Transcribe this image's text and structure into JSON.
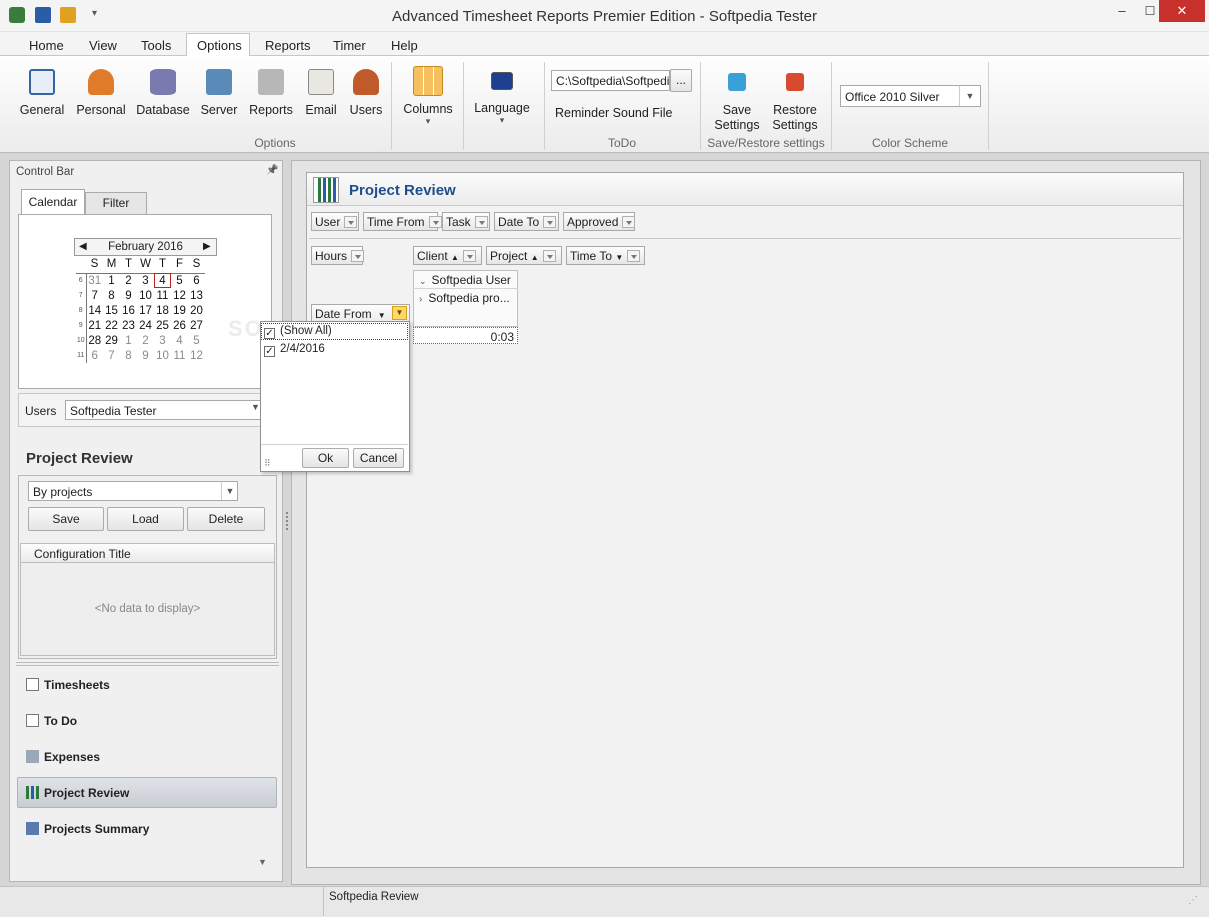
{
  "window": {
    "title": "Advanced Timesheet Reports Premier Edition - Softpedia Tester",
    "minimize": "–",
    "maximize": "☐",
    "close": "✕"
  },
  "menu": [
    "Home",
    "View",
    "Tools",
    "Options",
    "Reports",
    "Timer",
    "Help"
  ],
  "ribbon": {
    "options_buttons": [
      "General",
      "Personal",
      "Database",
      "Server",
      "Reports",
      "Email",
      "Users",
      "Columns",
      "Language"
    ],
    "options_group": "Options",
    "todo_path": "C:\\Softpedia\\Softpedia",
    "browse": "...",
    "reminder_label": "Reminder Sound File",
    "todo_group": "ToDo",
    "save_settings": "Save Settings",
    "restore_settings": "Restore Settings",
    "saverestore_group": "Save/Restore settings",
    "color_scheme_value": "Office 2010 Silver",
    "color_scheme_group": "Color Scheme",
    "colors": {
      "accent": "#1f4e8c",
      "ribbon": "#f4f4f4"
    }
  },
  "control_bar": {
    "title": "Control Bar",
    "pin": "📌",
    "tabs": [
      "Calendar",
      "Filter"
    ],
    "calendar": {
      "month": "February 2016",
      "weekdays": [
        "S",
        "M",
        "T",
        "W",
        "T",
        "F",
        "S"
      ],
      "weeks": [
        {
          "wk": "6",
          "days": [
            [
              "31",
              true
            ],
            [
              "1",
              false
            ],
            [
              "2",
              false
            ],
            [
              "3",
              false
            ],
            [
              "4",
              false
            ],
            [
              "5",
              false
            ],
            [
              "6",
              false
            ]
          ]
        },
        {
          "wk": "7",
          "days": [
            [
              "7",
              false
            ],
            [
              "8",
              false
            ],
            [
              "9",
              false
            ],
            [
              "10",
              false
            ],
            [
              "11",
              false
            ],
            [
              "12",
              false
            ],
            [
              "13",
              false
            ]
          ]
        },
        {
          "wk": "8",
          "days": [
            [
              "14",
              false
            ],
            [
              "15",
              false
            ],
            [
              "16",
              false
            ],
            [
              "17",
              false
            ],
            [
              "18",
              false
            ],
            [
              "19",
              false
            ],
            [
              "20",
              false
            ]
          ]
        },
        {
          "wk": "9",
          "days": [
            [
              "21",
              false
            ],
            [
              "22",
              false
            ],
            [
              "23",
              false
            ],
            [
              "24",
              false
            ],
            [
              "25",
              false
            ],
            [
              "26",
              false
            ],
            [
              "27",
              false
            ]
          ]
        },
        {
          "wk": "10",
          "days": [
            [
              "28",
              false
            ],
            [
              "29",
              false
            ],
            [
              "1",
              true
            ],
            [
              "2",
              true
            ],
            [
              "3",
              true
            ],
            [
              "4",
              true
            ],
            [
              "5",
              true
            ]
          ]
        },
        {
          "wk": "11",
          "days": [
            [
              "6",
              true
            ],
            [
              "7",
              true
            ],
            [
              "8",
              true
            ],
            [
              "9",
              true
            ],
            [
              "10",
              true
            ],
            [
              "11",
              true
            ],
            [
              "12",
              true
            ]
          ]
        }
      ],
      "today": "4"
    },
    "users_label": "Users",
    "users_value": "Softpedia Tester",
    "section_title": "Project Review",
    "config_select": "By projects",
    "save": "Save",
    "load": "Load",
    "delete": "Delete",
    "config_column": "Configuration Title",
    "no_data": "<No data to display>",
    "nav": [
      "Timesheets",
      "To Do",
      "Expenses",
      "Project Review",
      "Projects Summary"
    ],
    "nav_active": "Project Review"
  },
  "pivot": {
    "title": "Project Review",
    "filter_fields": [
      "User",
      "Time From",
      "Task",
      "Date To",
      "Approved"
    ],
    "data_field": "Hours",
    "column_fields": [
      "Client",
      "Project",
      "Time To"
    ],
    "row_field": "Date From",
    "col_values": [
      "Softpedia User",
      "Softpedia pro..."
    ],
    "cell_value": "0:03"
  },
  "popup": {
    "items": [
      "(Show All)",
      "2/4/2016"
    ],
    "ok": "Ok",
    "cancel": "Cancel"
  },
  "statusbar": {
    "text": "Softpedia Review"
  },
  "watermark": "SOFTPEDIA"
}
